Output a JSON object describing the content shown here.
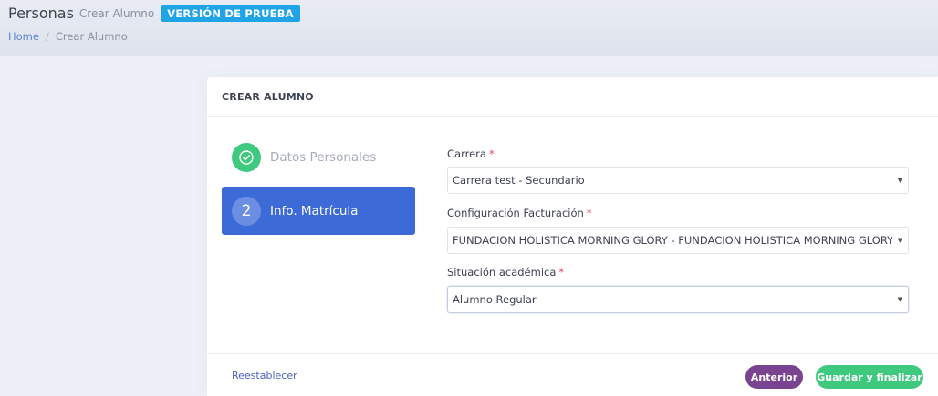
{
  "header": {
    "title": "Personas",
    "subtitle": "Crear Alumno",
    "badge": "VERSIÓN DE PRUEBA"
  },
  "breadcrumb": {
    "home": "Home",
    "separator": "/",
    "current": "Crear Alumno"
  },
  "card": {
    "title": "CREAR ALUMNO"
  },
  "steps": [
    {
      "icon": "check-circle-icon",
      "label": "Datos Personales",
      "status": "completed"
    },
    {
      "number": "2",
      "label": "Info. Matrícula",
      "status": "active"
    }
  ],
  "form": {
    "required_mark": "*",
    "carrera": {
      "label": "Carrera",
      "value": "Carrera test - Secundario"
    },
    "facturacion": {
      "label": "Configuración Facturación",
      "value": "FUNDACION HOLISTICA MORNING GLORY - FUNDACION HOLISTICA MORNING GLORY"
    },
    "situacion": {
      "label": "Situación académica",
      "value": "Alumno Regular"
    }
  },
  "footer": {
    "reset": "Reestablecer",
    "previous": "Anterior",
    "save": "Guardar y finalizar"
  },
  "colors": {
    "accent": "#3c6bd8",
    "success": "#3ec97f",
    "previous_button": "#7a4391",
    "badge": "#1fa4e8",
    "required": "#e8425d"
  }
}
